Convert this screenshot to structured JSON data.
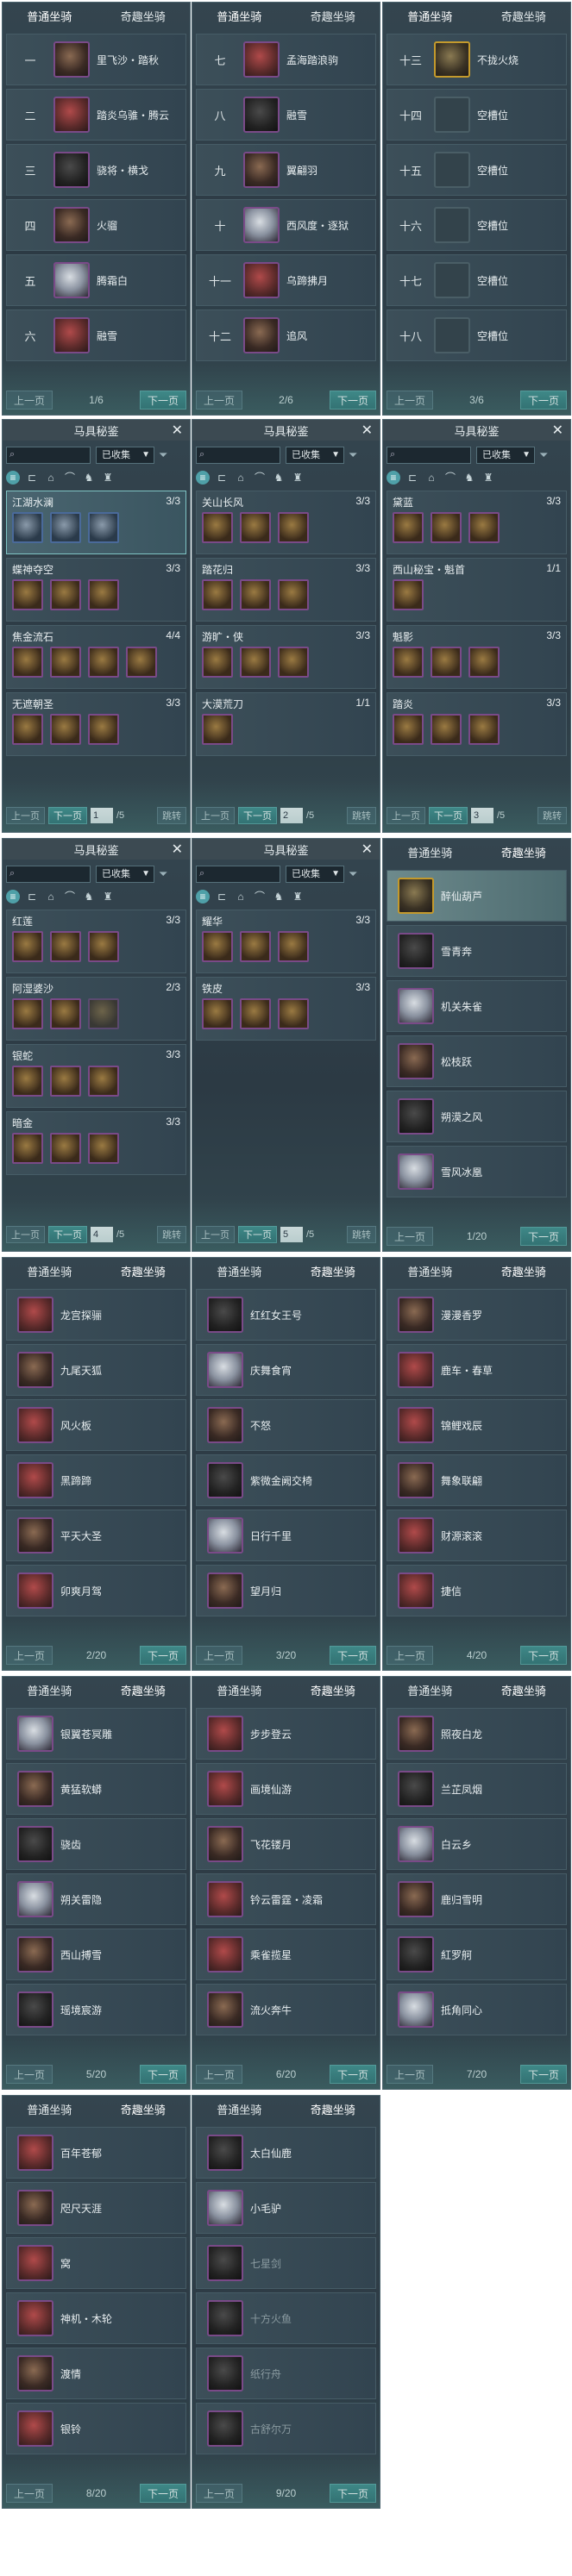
{
  "tabs": {
    "normal": "普通坐骑",
    "fancy": "奇趣坐骑"
  },
  "pager": {
    "prev": "上一页",
    "next": "下一页"
  },
  "book": {
    "title": "马具秘鉴",
    "filter_value": "已收集",
    "jump": "跳转",
    "prev": "上一页",
    "next": "下一页",
    "total": "/5"
  },
  "normal_panels": [
    {
      "page": "1/6",
      "rows": [
        {
          "idx": "一",
          "name": "里飞沙・踏秋"
        },
        {
          "idx": "二",
          "name": "踏炎乌骓・腾云"
        },
        {
          "idx": "三",
          "name": "骁将・横戈"
        },
        {
          "idx": "四",
          "name": "火骝"
        },
        {
          "idx": "五",
          "name": "腾霜白"
        },
        {
          "idx": "六",
          "name": "融雪"
        }
      ]
    },
    {
      "page": "2/6",
      "rows": [
        {
          "idx": "七",
          "name": "孟海踏浪驹"
        },
        {
          "idx": "八",
          "name": "融雪"
        },
        {
          "idx": "九",
          "name": "翼翩羽"
        },
        {
          "idx": "十",
          "name": "西风度・逐狱"
        },
        {
          "idx": "十一",
          "name": "乌蹄拂月"
        },
        {
          "idx": "十二",
          "name": "追风"
        }
      ]
    },
    {
      "page": "3/6",
      "rows": [
        {
          "idx": "十三",
          "name": "不拢火烧"
        },
        {
          "idx": "十四",
          "name": "空槽位"
        },
        {
          "idx": "十五",
          "name": "空槽位"
        },
        {
          "idx": "十六",
          "name": "空槽位"
        },
        {
          "idx": "十七",
          "name": "空槽位"
        },
        {
          "idx": "十八",
          "name": "空槽位"
        }
      ]
    }
  ],
  "book_panels": [
    {
      "page": "1",
      "sets": [
        {
          "name": "江湖水澜",
          "count": "3/3",
          "n": 3
        },
        {
          "name": "蝶神夺空",
          "count": "3/3",
          "n": 3
        },
        {
          "name": "焦金流石",
          "count": "4/4",
          "n": 4
        },
        {
          "name": "无遮朝圣",
          "count": "3/3",
          "n": 3
        }
      ]
    },
    {
      "page": "2",
      "sets": [
        {
          "name": "关山长风",
          "count": "3/3",
          "n": 3
        },
        {
          "name": "踏花归",
          "count": "3/3",
          "n": 3
        },
        {
          "name": "游旷・侠",
          "count": "3/3",
          "n": 3
        },
        {
          "name": "大漠荒刀",
          "count": "1/1",
          "n": 1
        }
      ]
    },
    {
      "page": "3",
      "sets": [
        {
          "name": "黛蓝",
          "count": "3/3",
          "n": 3
        },
        {
          "name": "西山秘宝・魁首",
          "count": "1/1",
          "n": 1
        },
        {
          "name": "魁影",
          "count": "3/3",
          "n": 3
        },
        {
          "name": "踏炎",
          "count": "3/3",
          "n": 3
        }
      ]
    },
    {
      "page": "4",
      "sets": [
        {
          "name": "红莲",
          "count": "3/3",
          "n": 3
        },
        {
          "name": "阿湿婆沙",
          "count": "2/3",
          "n": 3
        },
        {
          "name": "银蛇",
          "count": "3/3",
          "n": 3
        },
        {
          "name": "暗金",
          "count": "3/3",
          "n": 3
        }
      ]
    },
    {
      "page": "5",
      "sets": [
        {
          "name": "耀华",
          "count": "3/3",
          "n": 3
        },
        {
          "name": "铁皮",
          "count": "3/3",
          "n": 3
        }
      ]
    }
  ],
  "fancy_panels": [
    {
      "page": "1/20",
      "rows": [
        "醉仙葫芦",
        "雪青奔",
        "机关朱雀",
        "松枝跃",
        "朔漠之风",
        "雪风冰凰"
      ]
    },
    {
      "page": "2/20",
      "rows": [
        "龙宫探骊",
        "九尾天狐",
        "风火板",
        "黑蹄蹄",
        "平天大圣",
        "卯爽月驾"
      ]
    },
    {
      "page": "3/20",
      "rows": [
        "红红女王号",
        "庆舞食宵",
        "不怒",
        "紫微金阙交椅",
        "日行千里",
        "望月归"
      ]
    },
    {
      "page": "4/20",
      "rows": [
        "漫漫香罗",
        "鹿车・春草",
        "锦鲤戏辰",
        "舞象联翩",
        "财源滚滚",
        "捷信"
      ]
    },
    {
      "page": "5/20",
      "rows": [
        "银翼苍冥雕",
        "黄猛软蟒",
        "骁齿",
        "朔关雷隐",
        "西山搏雪",
        "瑶境宸游"
      ]
    },
    {
      "page": "6/20",
      "rows": [
        "步步登云",
        "画境仙游",
        "飞花镂月",
        "钤云雷霆・凌霜",
        "乘雀揽星",
        "流火奔牛"
      ]
    },
    {
      "page": "7/20",
      "rows": [
        "照夜白龙",
        "兰芷凤烟",
        "白云乡",
        "鹿归雪明",
        "紅罗舸",
        "抵角同心"
      ]
    },
    {
      "page": "8/20",
      "rows": [
        "百年苍郁",
        "咫尺天涯",
        "窝",
        "神机・木轮",
        "渡情",
        "银铃"
      ]
    },
    {
      "page": "9/20",
      "rows": [
        "太白仙鹿",
        "小毛驴",
        "七星剑",
        "十方火鱼",
        "纸行舟",
        "古舒尔万"
      ]
    }
  ]
}
